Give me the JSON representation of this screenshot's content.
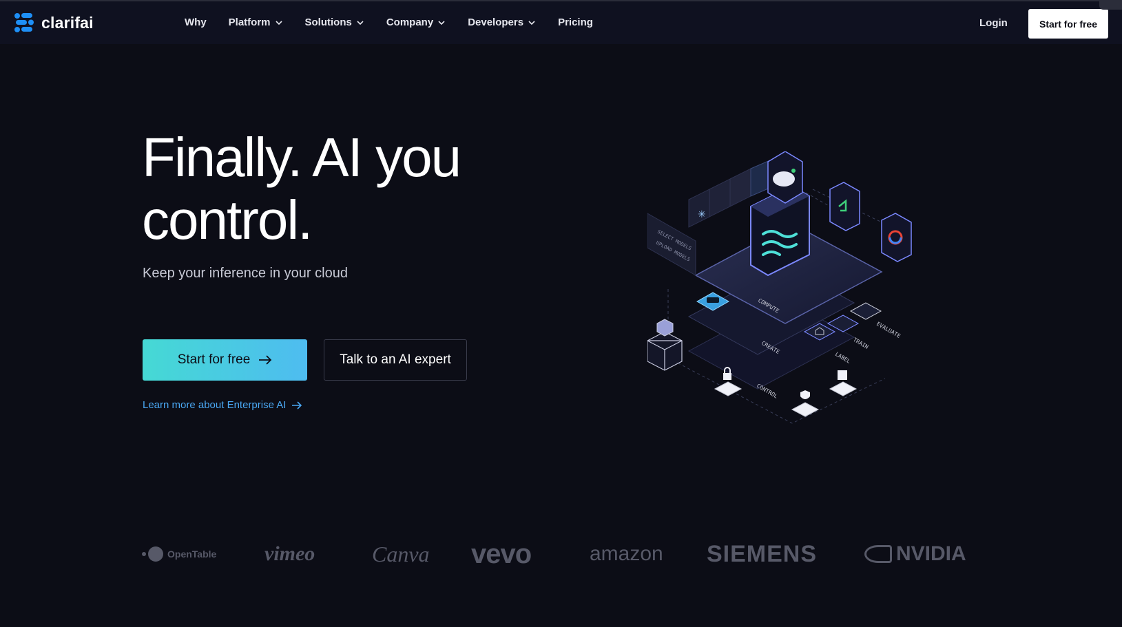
{
  "header": {
    "logo_text": "clarifai",
    "nav": [
      {
        "label": "Why",
        "has_dropdown": false
      },
      {
        "label": "Platform",
        "has_dropdown": true
      },
      {
        "label": "Solutions",
        "has_dropdown": true
      },
      {
        "label": "Company",
        "has_dropdown": true
      },
      {
        "label": "Developers",
        "has_dropdown": true
      },
      {
        "label": "Pricing",
        "has_dropdown": false
      }
    ],
    "login_label": "Login",
    "cta_label": "Start for free"
  },
  "hero": {
    "title_line1": "Finally. AI you",
    "title_line2": "control.",
    "subtitle": "Keep your inference in your cloud",
    "primary_button": "Start for free",
    "secondary_button": "Talk to an AI expert",
    "learn_more": "Learn more about Enterprise AI"
  },
  "illustration": {
    "labels": {
      "select": "SELECT MODELS",
      "upload": "UPLOAD MODELS",
      "compute": "COMPUTE",
      "create": "CREATE",
      "label": "LABEL",
      "train": "TRAIN",
      "evaluate": "EVALUATE",
      "control": "CONTROL"
    }
  },
  "customer_logos": [
    "OpenTable",
    "vimeo",
    "Canva",
    "vevo",
    "amazon",
    "SIEMENS",
    "NVIDIA"
  ],
  "colors": {
    "background": "#0c0d16",
    "accent_cyan": "#45d9d4",
    "accent_blue": "#4ebcf0",
    "link": "#4aa8f4",
    "logo_gray": "#575968"
  }
}
